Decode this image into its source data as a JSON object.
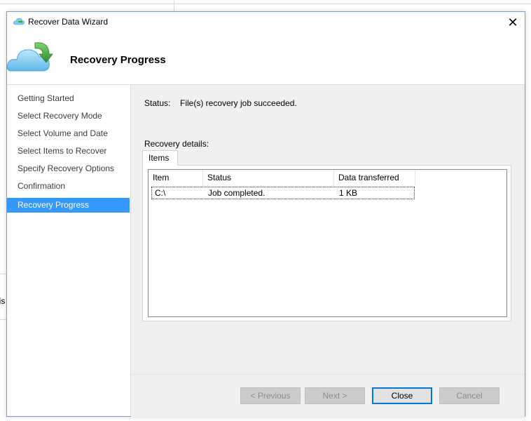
{
  "background": {
    "partial_text": "nis"
  },
  "window": {
    "title": "Recover Data Wizard",
    "close_glyph": "✕"
  },
  "header": {
    "title": "Recovery Progress",
    "icon": "cloud-recover-icon"
  },
  "nav": {
    "items": [
      {
        "label": "Getting Started"
      },
      {
        "label": "Select Recovery Mode"
      },
      {
        "label": "Select Volume and Date"
      },
      {
        "label": "Select Items to Recover"
      },
      {
        "label": "Specify Recovery Options"
      },
      {
        "label": "Confirmation"
      },
      {
        "label": "Recovery Progress",
        "active": true
      }
    ]
  },
  "status": {
    "label": "Status:",
    "value": "File(s) recovery job succeeded."
  },
  "details": {
    "label": "Recovery details:",
    "tab_label": "Items",
    "columns": [
      "Item",
      "Status",
      "Data transferred"
    ],
    "rows": [
      {
        "item": "C:\\",
        "status": "Job completed.",
        "data_transferred": "1 KB"
      }
    ]
  },
  "buttons": {
    "previous": "< Previous",
    "next": "Next >",
    "close": "Close",
    "cancel": "Cancel"
  },
  "colors": {
    "accent": "#3399ff",
    "focus_border": "#0078d7",
    "cloud_blue": "#7ecbf0",
    "arrow_green": "#3aa63a"
  }
}
